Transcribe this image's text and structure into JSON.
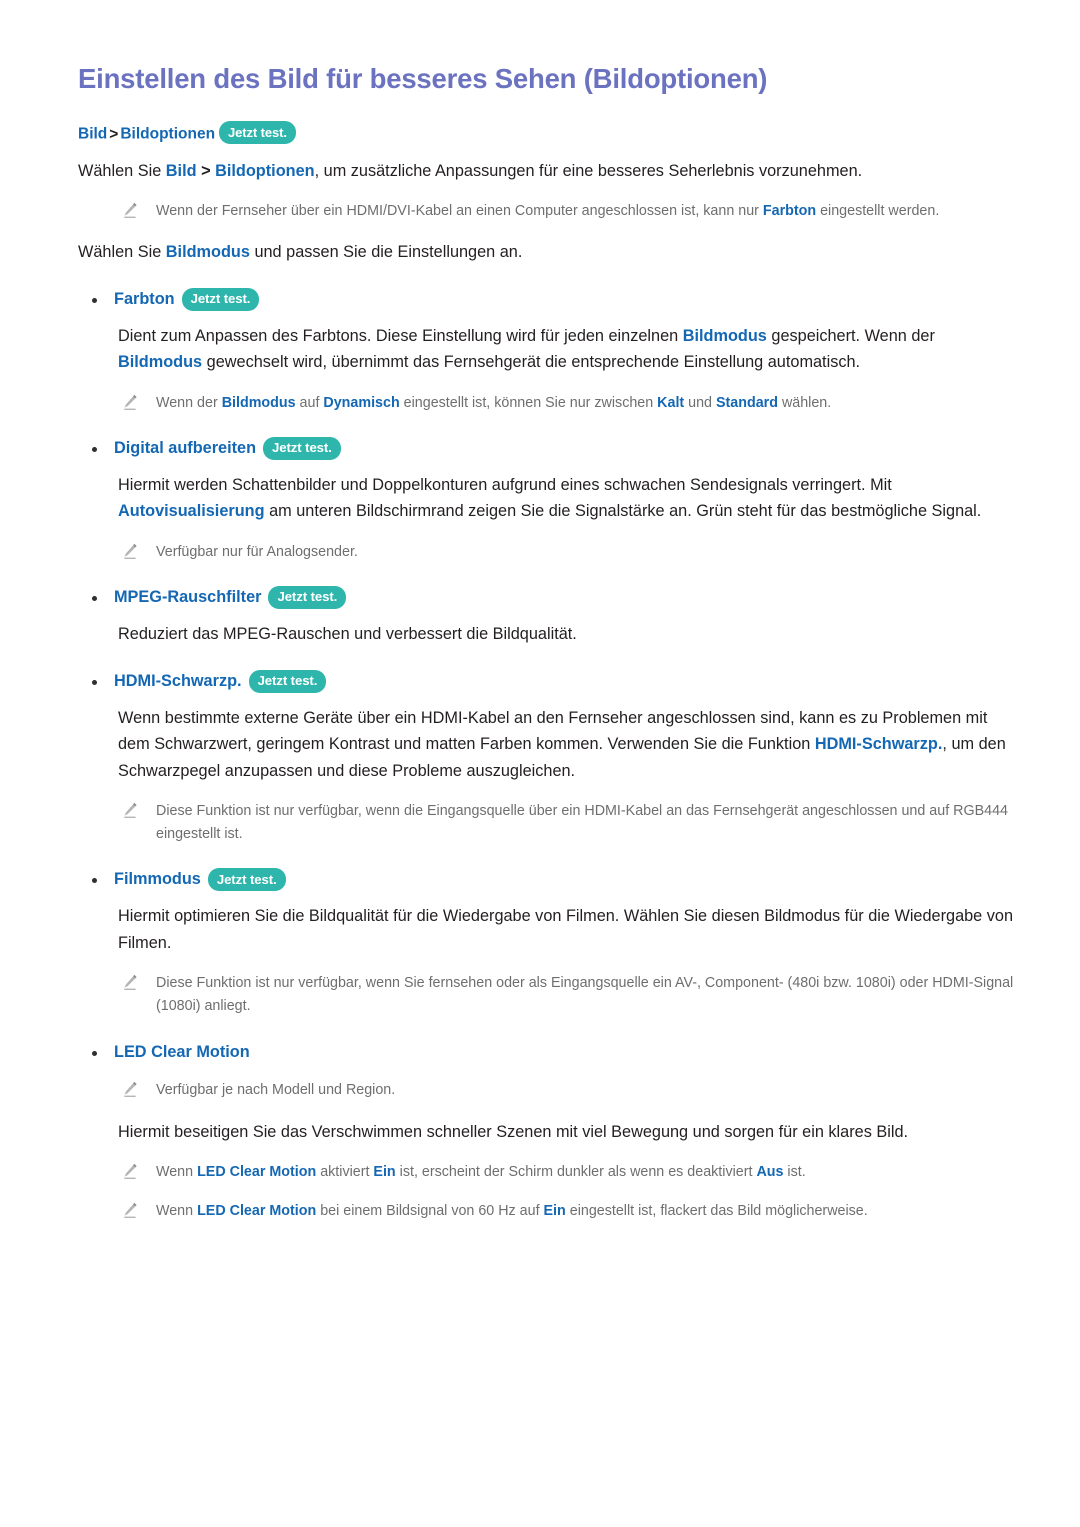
{
  "document": {
    "title": "Einstellen des Bild für besseres Sehen (Bildoptionen)",
    "colors": {
      "title": "#6b72c0",
      "link": "#1467b3",
      "badge_background": "#2fb6ac",
      "badge_text": "#ffffff",
      "body_text": "#231f20",
      "note_text": "#6e6e6e",
      "page_background": "#ffffff"
    },
    "badge_label": "Jetzt test.",
    "note_icon": "pencil-icon",
    "bullet_icon": "bullet-dot-icon"
  },
  "breadcrumb": {
    "item1": "Bild",
    "separator": ">",
    "item2": "Bildoptionen",
    "badge": "Jetzt test."
  },
  "intro": {
    "p1_a": "Wählen Sie ",
    "p1_link1": "Bild",
    "p1_sep": " > ",
    "p1_link2": "Bildoptionen",
    "p1_b": ", um zusätzliche Anpassungen für eine besseres Seherlebnis vorzunehmen.",
    "note1_a": "Wenn der Fernseher über ein HDMI/DVI-Kabel an einen Computer angeschlossen ist, kann nur ",
    "note1_b": "Farbton",
    "note1_c": " eingestellt werden.",
    "p2_a": "Wählen Sie ",
    "p2_link": "Bildmodus",
    "p2_b": " und passen Sie die Einstellungen an."
  },
  "sections": [
    {
      "heading": "Farbton",
      "badge": "Jetzt test.",
      "body_a": "Dient zum Anpassen des Farbtons. Diese Einstellung wird für jeden einzelnen ",
      "body_link1": "Bildmodus",
      "body_b": " gespeichert. Wenn der ",
      "body_link2": "Bildmodus",
      "body_c": " gewechselt wird, übernimmt das Fernsehgerät die entsprechende Einstellung automatisch.",
      "note_a": "Wenn der ",
      "note_b1": "Bildmodus",
      "note_c": " auf ",
      "note_b2": "Dynamisch",
      "note_d": " eingestellt ist, können Sie nur zwischen ",
      "note_b3": "Kalt",
      "note_e": " und ",
      "note_b4": "Standard",
      "note_f": " wählen."
    },
    {
      "heading": "Digital aufbereiten",
      "badge": "Jetzt test.",
      "body_a": "Hiermit werden Schattenbilder und Doppelkonturen aufgrund eines schwachen Sendesignals verringert. Mit ",
      "body_link1": "Autovisualisierung",
      "body_b": " am unteren Bildschirmrand zeigen Sie die Signalstärke an. Grün steht für das bestmögliche Signal.",
      "note": "Verfügbar nur für Analogsender."
    },
    {
      "heading": "MPEG-Rauschfilter",
      "badge": "Jetzt test.",
      "body": "Reduziert das MPEG-Rauschen und verbessert die Bildqualität."
    },
    {
      "heading": "HDMI-Schwarzp.",
      "badge": "Jetzt test.",
      "body_a": "Wenn bestimmte externe Geräte über ein HDMI-Kabel an den Fernseher angeschlossen sind, kann es zu Problemen mit dem Schwarzwert, geringem Kontrast und matten Farben kommen. Verwenden Sie die Funktion ",
      "body_link1": "HDMI-Schwarzp.",
      "body_b": ", um den Schwarzpegel anzupassen und diese Probleme auszugleichen.",
      "note": "Diese Funktion ist nur verfügbar, wenn die Eingangsquelle über ein HDMI-Kabel an das Fernsehgerät angeschlossen und auf RGB444 eingestellt ist."
    },
    {
      "heading": "Filmmodus",
      "badge": "Jetzt test.",
      "body": "Hiermit optimieren Sie die Bildqualität für die Wiedergabe von Filmen. Wählen Sie diesen Bildmodus für die Wiedergabe von Filmen.",
      "note": "Diese Funktion ist nur verfügbar, wenn Sie fernsehen oder als Eingangsquelle ein AV-, Component- (480i bzw. 1080i) oder HDMI-Signal (1080i) anliegt."
    },
    {
      "heading": "LED Clear Motion",
      "badge": "",
      "note1": "Verfügbar je nach Modell und Region.",
      "body": "Hiermit beseitigen Sie das Verschwimmen schneller Szenen mit viel Bewegung und sorgen für ein klares Bild.",
      "note2_a": "Wenn ",
      "note2_b1": "LED Clear Motion",
      "note2_c": " aktiviert ",
      "note2_b2": "Ein",
      "note2_d": " ist, erscheint der Schirm dunkler als wenn es deaktiviert ",
      "note2_b3": "Aus",
      "note2_e": " ist.",
      "note3_a": "Wenn ",
      "note3_b1": "LED Clear Motion",
      "note3_c": " bei einem Bildsignal von 60 Hz auf ",
      "note3_b2": "Ein",
      "note3_d": " eingestellt ist, flackert das Bild möglicherweise."
    }
  ]
}
